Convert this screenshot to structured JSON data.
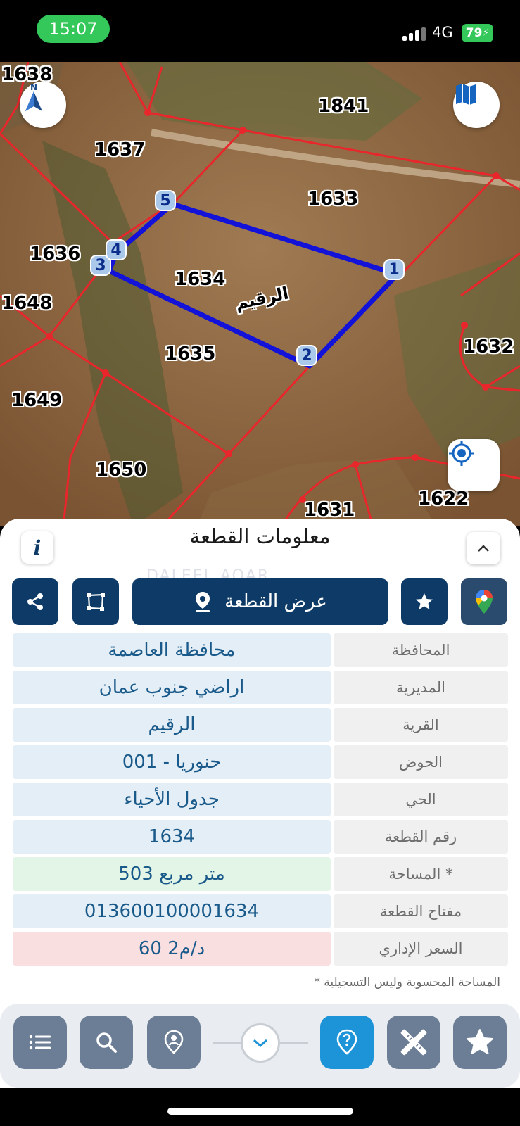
{
  "status_bar": {
    "time": "15:07",
    "network": "4G",
    "battery": "79"
  },
  "map": {
    "parcels": [
      "1638",
      "1841",
      "1637",
      "1633",
      "1636",
      "1634",
      "1648",
      "1632",
      "1635",
      "1649",
      "1650",
      "1622",
      "1631"
    ],
    "vertices": [
      "1",
      "2",
      "3",
      "4",
      "5"
    ],
    "village_label": "الرقيم",
    "north_label": "N",
    "icons": [
      "compass-north-icon",
      "map-book-icon",
      "locate-me-icon"
    ]
  },
  "sheet": {
    "title": "معلومات القطعة",
    "watermark": "DALEEL AQAR",
    "actions": {
      "show_parcel": "عرض القطعة"
    },
    "rows": [
      {
        "label": "المحافظة",
        "value": "محافظة العاصمة",
        "tint": "#e3eef6"
      },
      {
        "label": "المديرية",
        "value": "اراضي جنوب عمان",
        "tint": "#e3eef6"
      },
      {
        "label": "القرية",
        "value": "الرقيم",
        "tint": "#e3eef6"
      },
      {
        "label": "الحوض",
        "value": "حنوريا - 001",
        "tint": "#e3eef6"
      },
      {
        "label": "الحي",
        "value": "جدول الأحياء",
        "tint": "#e3eef6"
      },
      {
        "label": "رقم القطعة",
        "value": "1634",
        "tint": "#e3eef6"
      },
      {
        "label": "المساحة *",
        "value": "503  متر مربع",
        "tint": "#e2f5e6"
      },
      {
        "label": "مفتاح القطعة",
        "value": "013600100001634",
        "tint": "#e3eef6"
      },
      {
        "label": "السعر الإداري",
        "value": "60 د/م2",
        "tint": "#f9dfe0"
      }
    ],
    "footnote": "* المساحة المحسوبة وليس التسجيلية"
  },
  "bottom_bar": {
    "icons": [
      "list-icon",
      "search-icon",
      "location-pin-icon",
      "chevron-down-icon",
      "help-pin-icon",
      "measure-tools-icon",
      "star-icon"
    ]
  },
  "colors": {
    "primary": "#0d3a66",
    "accent": "#1e94d8",
    "parcel_outline": "#e8262b",
    "selected_outline": "#1212d8"
  }
}
